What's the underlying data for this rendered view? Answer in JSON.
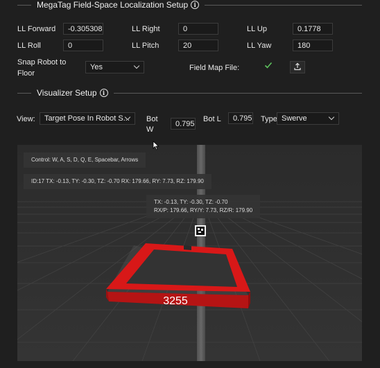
{
  "localization": {
    "title": "MegaTag Field-Space Localization Setup",
    "ll_forward_label": "LL Forward",
    "ll_forward_value": "-0.305308",
    "ll_right_label": "LL Right",
    "ll_right_value": "0",
    "ll_up_label": "LL Up",
    "ll_up_value": "0.1778",
    "ll_roll_label": "LL Roll",
    "ll_roll_value": "0",
    "ll_pitch_label": "LL Pitch",
    "ll_pitch_value": "20",
    "ll_yaw_label": "LL Yaw",
    "ll_yaw_value": "180",
    "snap_label_1": "Snap Robot to",
    "snap_label_2": "Floor",
    "snap_value": "Yes",
    "field_map_label": "Field Map File:"
  },
  "visualizer": {
    "title": "Visualizer Setup",
    "view_label": "View:",
    "view_value": "Target Pose In Robot S...",
    "bot_w_label_1": "Bot",
    "bot_w_label_2": "W",
    "bot_w_value": "0.795",
    "bot_l_label": "Bot L",
    "bot_l_value": "0.795",
    "type_label": "Type",
    "type_value": "Swerve"
  },
  "scene": {
    "controls_tip": "Control: W, A, S, D, Q, E, Spacebar, Arrows",
    "id_tip": "ID:17 TX: -0.13, TY: -0.30, TZ: -0.70 RX: 179.66, RY: 7.73, RZ: 179.90",
    "pose_tip_line1": "TX: -0.13, TY: -0.30, TZ: -0.70",
    "pose_tip_line2": "RX/P: 179.66, RY/Y: 7.73, RZ/R: 179.90",
    "bumper_number": "3255"
  },
  "colors": {
    "background": "#1f1f1f",
    "bumper_red": "#d81818",
    "check_green": "#5ec35e"
  },
  "icons": {
    "check": "check-icon",
    "upload": "upload-icon",
    "info": "info-icon"
  }
}
